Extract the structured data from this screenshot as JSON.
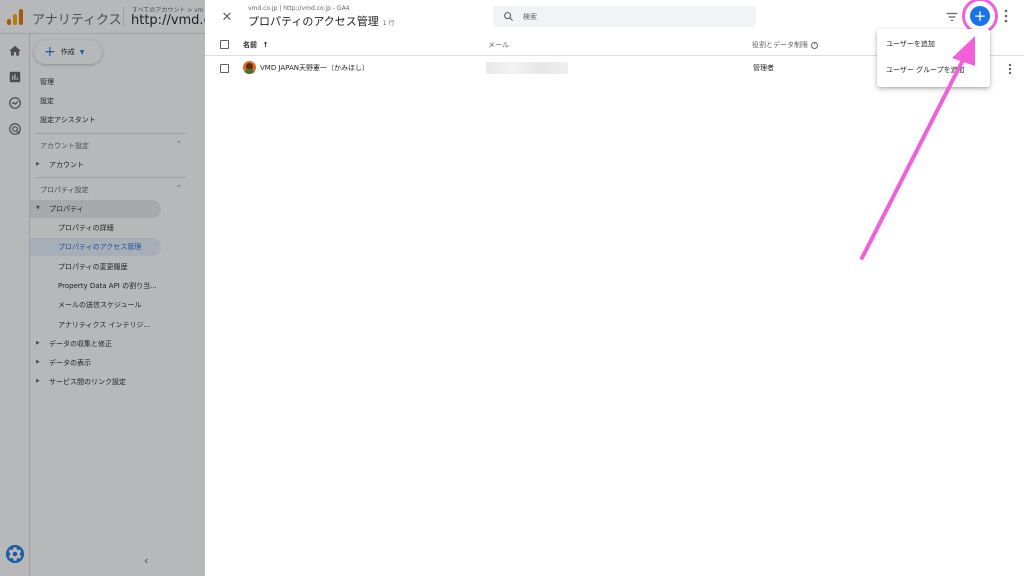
{
  "topbar": {
    "app_name": "アナリティクス",
    "account_crumb": "すべてのアカウント > vm",
    "account_title": "http://vmd.co"
  },
  "nav": {
    "create_label": "作成",
    "admin": "管理",
    "settings": "設定",
    "setup_assistant": "設定アシスタント",
    "account_settings_group": "アカウント設定",
    "account": "アカウント",
    "property_settings_group": "プロパティ設定",
    "property": "プロパティ",
    "property_details": "プロパティの詳細",
    "property_access": "プロパティのアクセス管理",
    "property_history": "プロパティの変更履歴",
    "property_data_api": "Property Data API の割り当...",
    "email_schedule": "メールの送信スケジュール",
    "analytics_intelligence": "アナリティクス インテリジ...",
    "data_collection": "データの収集と修正",
    "data_display": "データの表示",
    "service_links": "サービス間のリンク設定"
  },
  "panel": {
    "breadcrumb": "vmd.co.jp | http://vmd.co.jp - GA4",
    "title": "プロパティのアクセス管理",
    "row_count": "1 行",
    "search_placeholder": "検索",
    "add_button_label": "+"
  },
  "table": {
    "columns": {
      "name": "名前",
      "email": "メール",
      "role": "役割とデータ制限"
    },
    "rows": [
      {
        "name": "VMD JAPAN天野憲一（かみほし）",
        "email": "",
        "role": "管理者"
      }
    ]
  },
  "add_menu": {
    "items": [
      "ユーザーを追加",
      "ユーザー グループを追加"
    ]
  },
  "colors": {
    "accent": "#1a73e8",
    "highlight": "#f15fd9",
    "ga_orange": "#e37400",
    "ga_yellow": "#f9ab00"
  },
  "icons": {
    "close": "close-icon",
    "search": "search-icon",
    "filter": "filter-icon",
    "more": "more-vert-icon",
    "home": "home-icon",
    "reports": "reports-icon",
    "explore": "explore-icon",
    "advertising": "advertising-icon",
    "settings": "gear-icon"
  }
}
